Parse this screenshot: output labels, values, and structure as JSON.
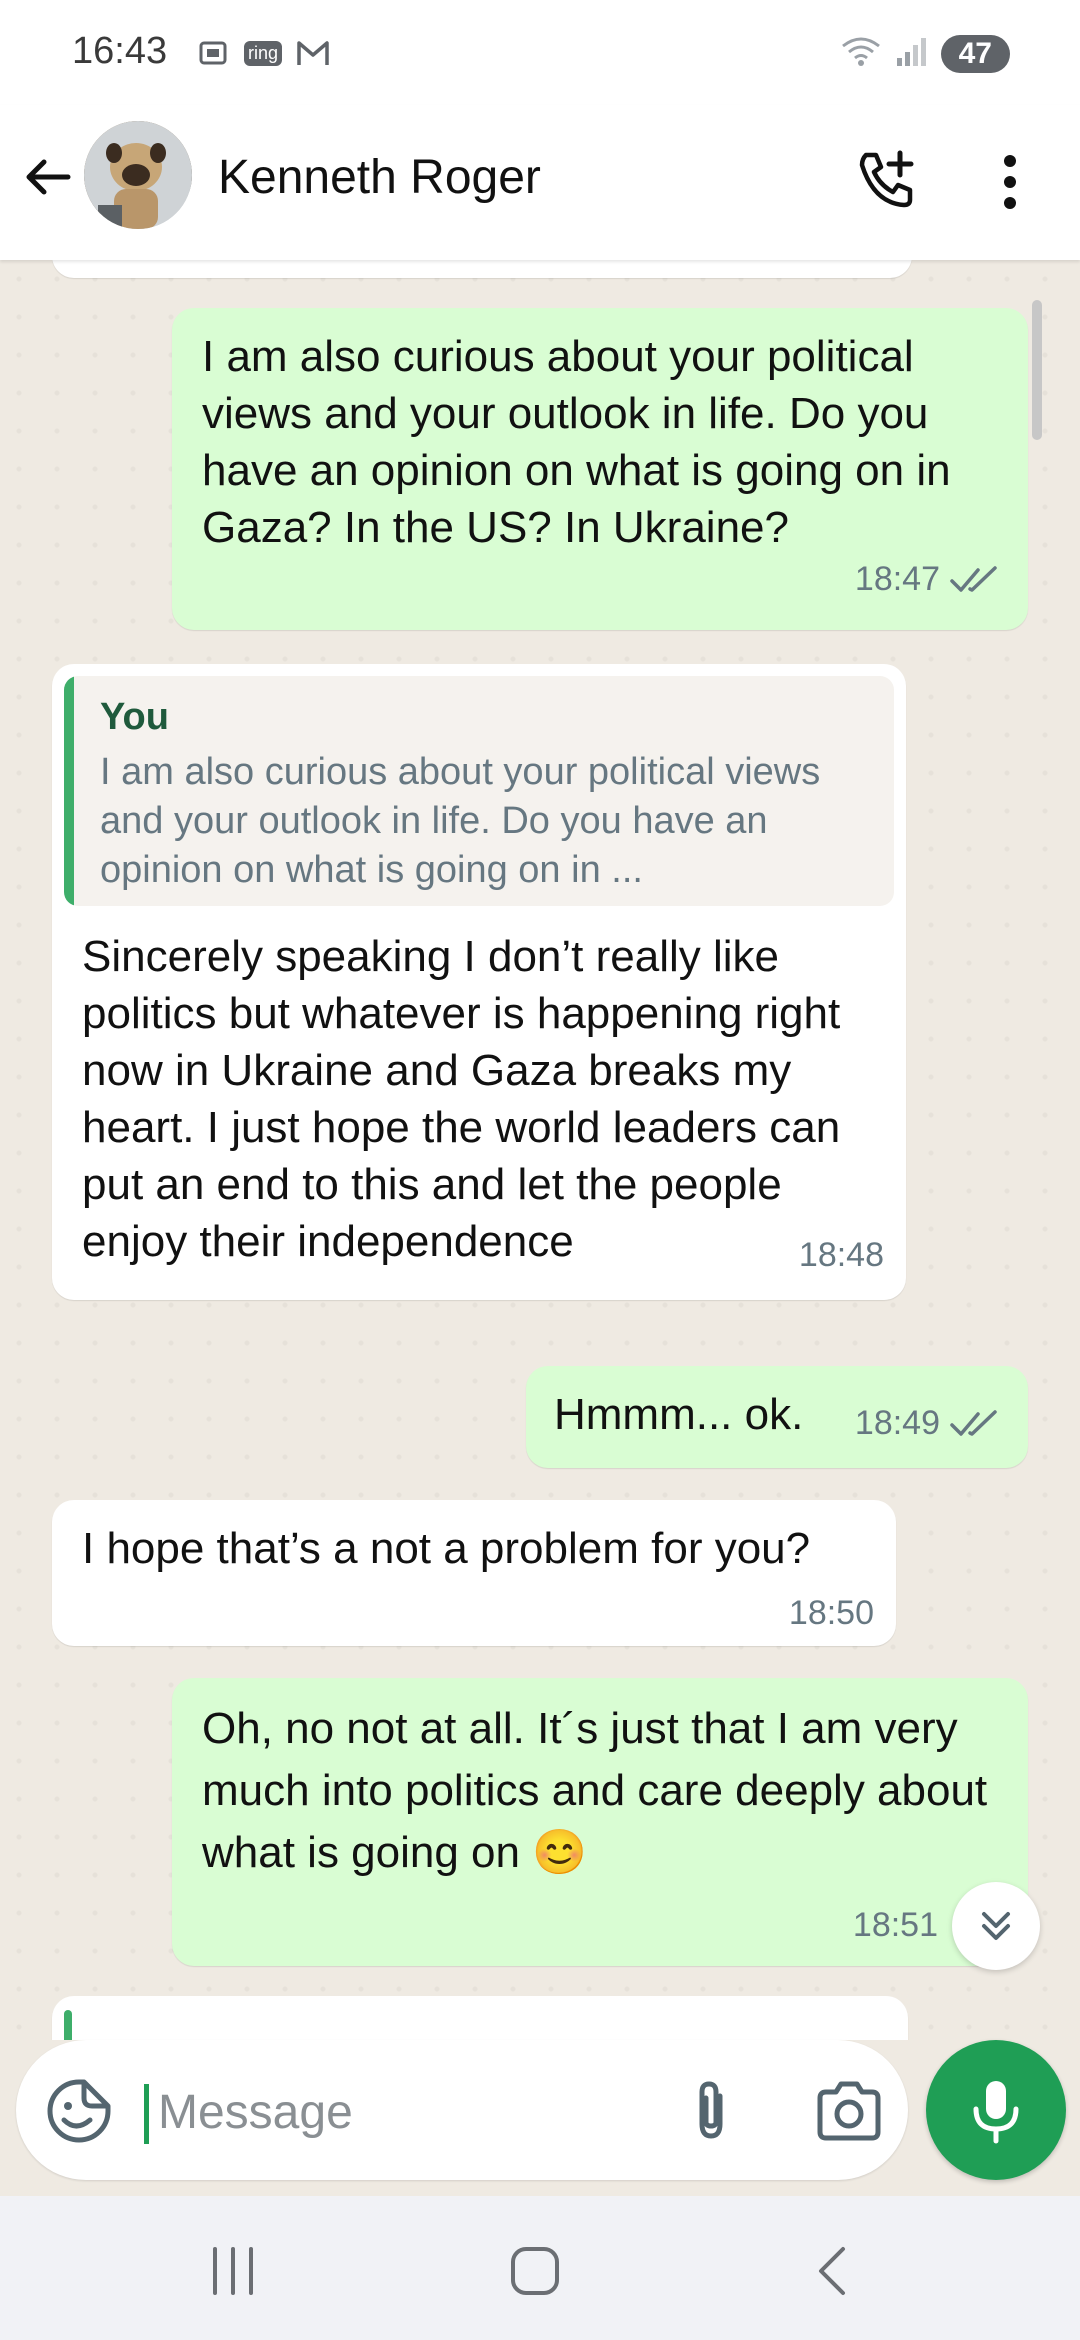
{
  "status_bar": {
    "time": "16:43",
    "battery": "47",
    "ring_label": "ring"
  },
  "header": {
    "contact_name": "Kenneth Roger"
  },
  "messages": [
    {
      "direction": "outgoing",
      "text": "I am also curious about your political views and your outlook in life. Do you have an opinion on what is going on in Gaza? In the US? In Ukraine?",
      "time": "18:47",
      "status": "read"
    },
    {
      "direction": "incoming",
      "reply_to": {
        "author": "You",
        "text": "I am also curious about your political views and your outlook in life. Do you have an opinion on what is going on in ..."
      },
      "text": "Sincerely speaking I don’t really like politics but whatever is happening right now in Ukraine and Gaza breaks my heart.  I just hope the world leaders can put an end to this and let the people enjoy their independence",
      "time": "18:48"
    },
    {
      "direction": "outgoing",
      "text": "Hmmm... ok.",
      "time": "18:49",
      "status": "read"
    },
    {
      "direction": "incoming",
      "text": "I hope that’s a not a problem for you?",
      "time": "18:50"
    },
    {
      "direction": "outgoing",
      "text": "Oh, no not at all. It´s just that I am very much into politics and care deeply about what is going on 😊",
      "time": "18:51",
      "status": "read"
    }
  ],
  "composer": {
    "placeholder": "Message"
  },
  "colors": {
    "accent": "#1f9e55",
    "outgoing_bubble": "#d9fdd3",
    "incoming_bubble": "#ffffff",
    "chat_bg": "#efeae2",
    "tick_read": "#667781"
  },
  "icons": {
    "back": "arrow-left-icon",
    "call_add": "call-add-icon",
    "more": "more-vertical-icon",
    "sticker": "sticker-icon",
    "attach": "paperclip-icon",
    "camera": "camera-icon",
    "mic": "mic-icon",
    "scroll_down": "double-chevron-down-icon"
  }
}
